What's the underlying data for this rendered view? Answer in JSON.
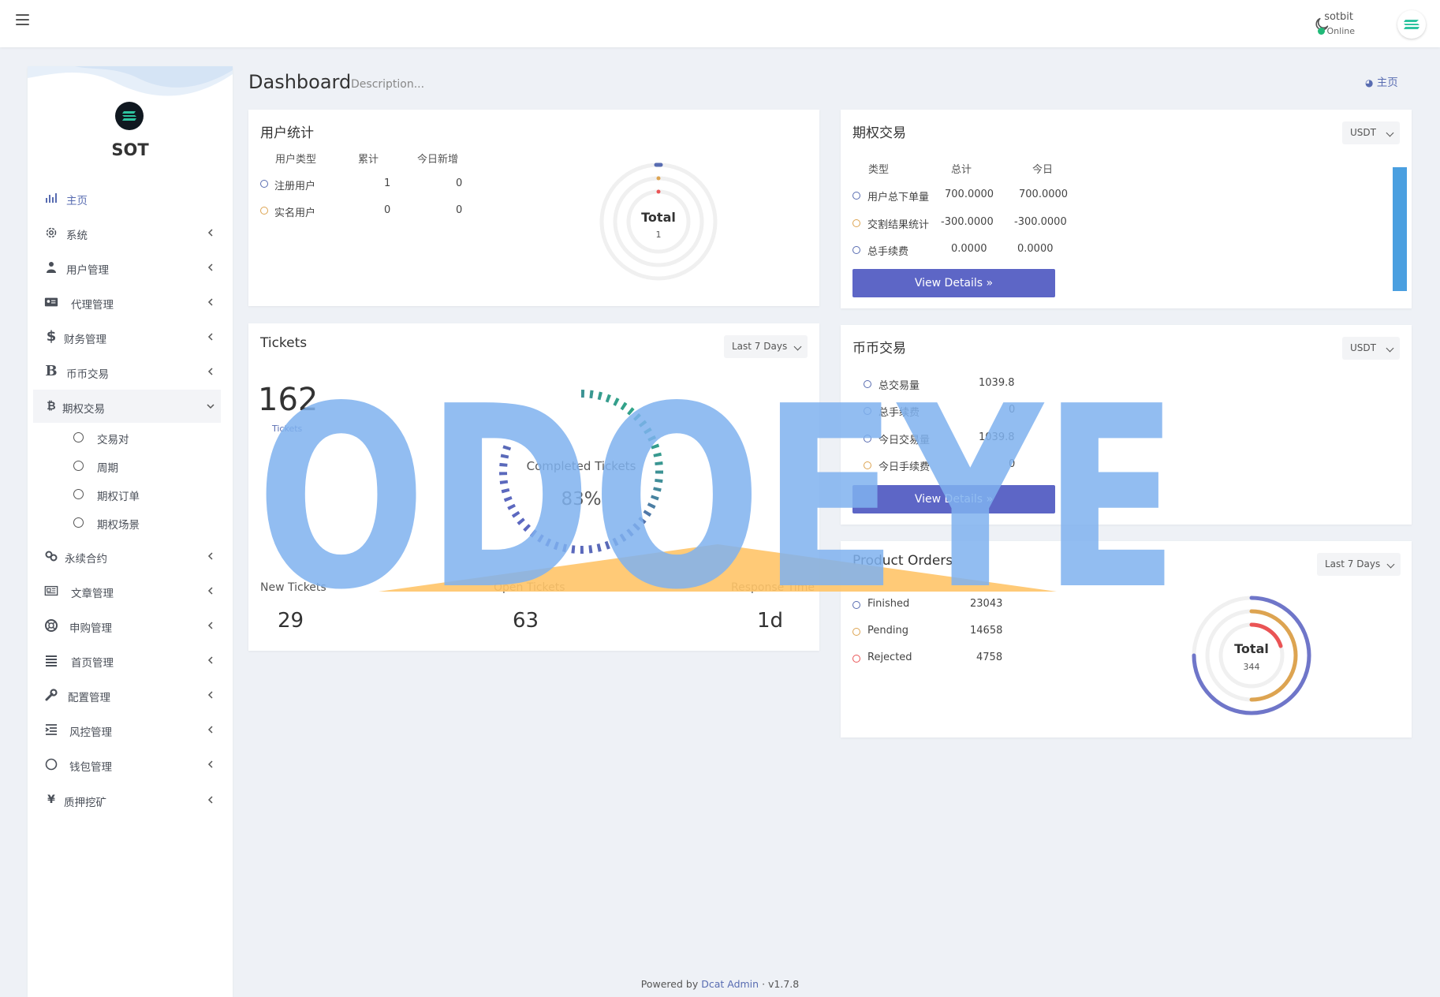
{
  "navbar": {
    "username": "sotbit",
    "status": "Online"
  },
  "sidebar": {
    "brand": "SOT",
    "items": [
      {
        "label": "主页",
        "icon": "bar-chart-icon"
      },
      {
        "label": "系统",
        "icon": "gear-icon"
      },
      {
        "label": "用户管理",
        "icon": "users-icon"
      },
      {
        "label": "代理管理",
        "icon": "id-card-icon"
      },
      {
        "label": "财务管理",
        "icon": "dollar-icon"
      },
      {
        "label": "币币交易",
        "icon": "bitcoin-b-icon"
      },
      {
        "label": "期权交易",
        "icon": "bitcoin-icon"
      },
      {
        "label": "永续合约",
        "icon": "link-icon"
      },
      {
        "label": "文章管理",
        "icon": "newspaper-icon"
      },
      {
        "label": "申购管理",
        "icon": "lifebuoy-icon"
      },
      {
        "label": "首页管理",
        "icon": "list-icon"
      },
      {
        "label": "配置管理",
        "icon": "wrench-icon"
      },
      {
        "label": "风控管理",
        "icon": "indent-icon"
      },
      {
        "label": "钱包管理",
        "icon": "circle-icon"
      },
      {
        "label": "质押挖矿",
        "icon": "yen-icon"
      }
    ],
    "subitems": [
      "交易对",
      "周期",
      "期权订单",
      "期权场景"
    ]
  },
  "header": {
    "title": "Dashboard",
    "description": "Description...",
    "breadcrumb": "主页"
  },
  "user_stats": {
    "title": "用户统计",
    "headers": [
      "用户类型",
      "累计",
      "今日新增"
    ],
    "rows": [
      {
        "name": "注册用户",
        "total": "1",
        "today": "0"
      },
      {
        "name": "实名用户",
        "total": "0",
        "today": "0"
      }
    ],
    "donut_label": "Total",
    "donut_value": "1"
  },
  "options_trade": {
    "title": "期权交易",
    "currency": "USDT",
    "headers": [
      "类型",
      "总计",
      "今日"
    ],
    "rows": [
      {
        "name": "用户总下单量",
        "total": "700.0000",
        "today": "700.0000"
      },
      {
        "name": "交割结果统计",
        "total": "-300.0000",
        "today": "-300.0000"
      },
      {
        "name": "总手续费",
        "total": "0.0000",
        "today": "0.0000"
      }
    ],
    "button": "View Details"
  },
  "tickets": {
    "title": "Tickets",
    "range": "Last 7 Days",
    "total": "162",
    "total_label": "Tickets",
    "gauge_label": "Completed Tickets",
    "gauge_value": "83%",
    "gauge_fraction": 0.83,
    "stats": [
      {
        "label": "New Tickets",
        "value": "29"
      },
      {
        "label": "Open Tickets",
        "value": "63"
      },
      {
        "label": "Response Time",
        "value": "1d"
      }
    ]
  },
  "spot_trade": {
    "title": "币币交易",
    "currency": "USDT",
    "rows": [
      {
        "name": "总交易量",
        "value": "1039.8"
      },
      {
        "name": "总手续费",
        "value": "0"
      },
      {
        "name": "今日交易量",
        "value": "1039.8"
      },
      {
        "name": "今日手续费",
        "value": "0"
      }
    ],
    "button": "View Details"
  },
  "product_orders": {
    "title": "Product Orders",
    "range": "Last 7 Days",
    "rows": [
      {
        "name": "Finished",
        "value": "23043"
      },
      {
        "name": "Pending",
        "value": "14658"
      },
      {
        "name": "Rejected",
        "value": "4758"
      }
    ],
    "donut_label": "Total",
    "donut_value": "344"
  },
  "watermark": "ODOEYE",
  "footer": {
    "prefix": "Powered by",
    "link": "Dcat Admin",
    "version": "v1.7.8"
  },
  "colors": {
    "primary": "#586cb1",
    "button": "#5d66c6",
    "orange": "#dda451",
    "red": "#ea5455",
    "green": "#21b978",
    "bar_blue": "#4a9fe0"
  }
}
